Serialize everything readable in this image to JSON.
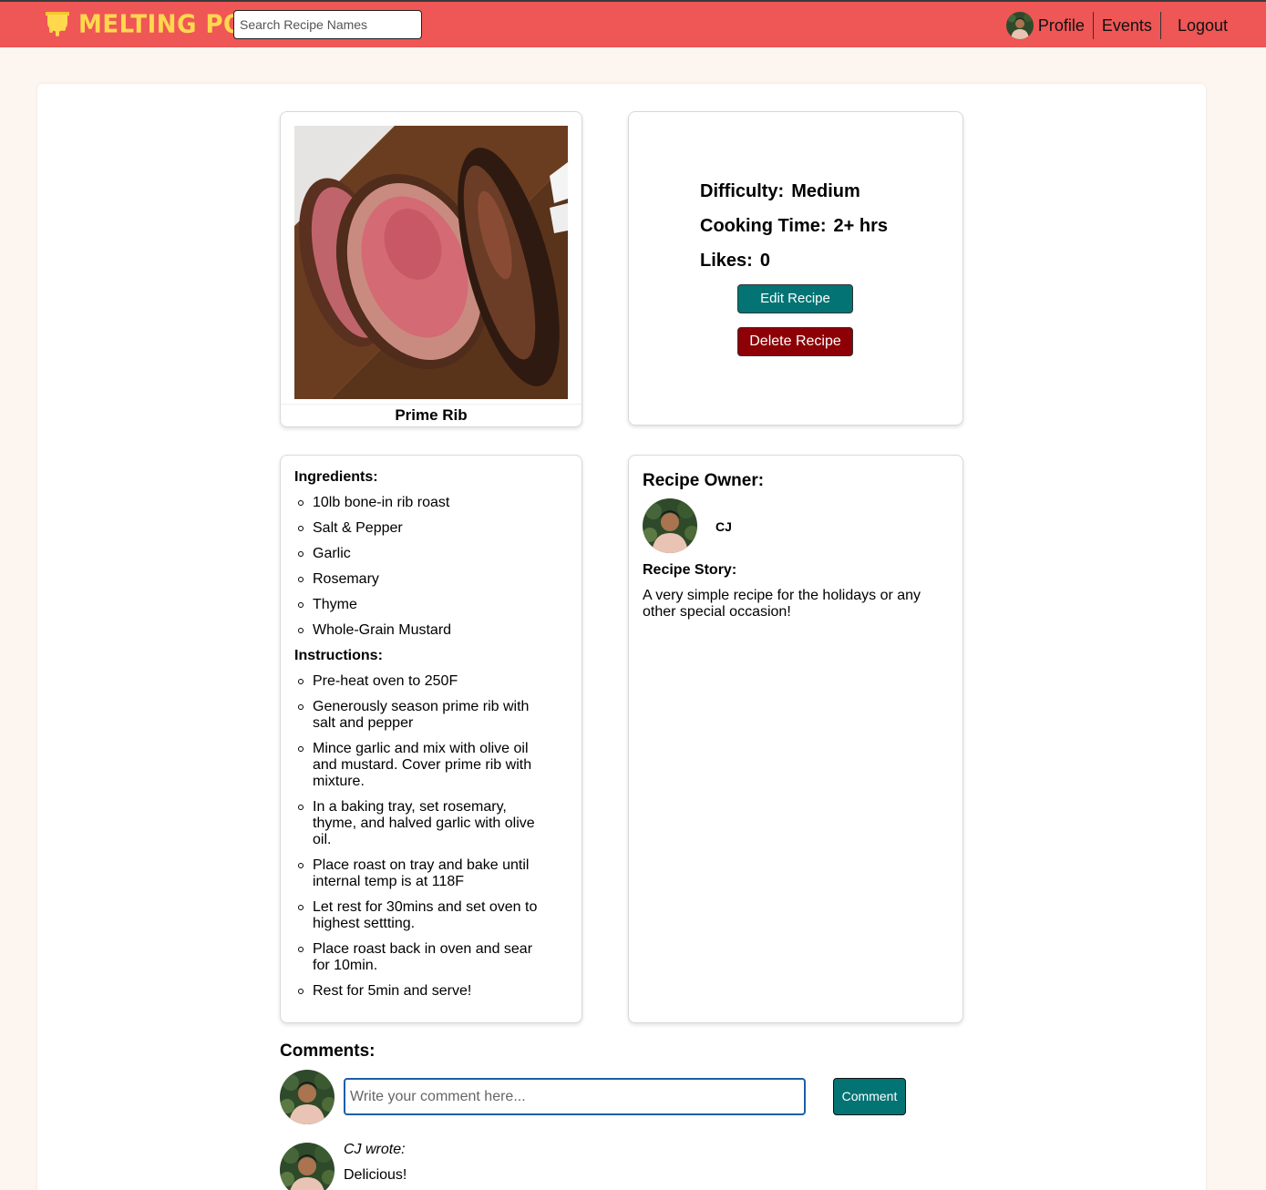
{
  "nav": {
    "logo_text": "MELTING POT",
    "search_placeholder": "Search Recipe Names",
    "profile_label": "Profile",
    "events_label": "Events",
    "logout_label": "Logout"
  },
  "recipe": {
    "name": "Prime Rib",
    "difficulty_label": "Difficulty:",
    "difficulty_value": "Medium",
    "cooking_time_label": "Cooking Time:",
    "cooking_time_value": "2+ hrs",
    "likes_label": "Likes:",
    "likes_value": "0",
    "edit_button": "Edit Recipe",
    "delete_button": "Delete Recipe",
    "ingredients_title": "Ingredients:",
    "ingredients": [
      "10lb bone-in rib roast",
      "Salt & Pepper",
      "Garlic",
      "Rosemary",
      "Thyme",
      "Whole-Grain Mustard"
    ],
    "instructions_title": "Instructions:",
    "instructions": [
      "Pre-heat oven to 250F",
      "Generously season prime rib with salt and pepper",
      "Mince garlic and mix with olive oil and mustard. Cover prime rib with mixture.",
      "In a baking tray, set rosemary, thyme, and halved garlic with olive oil.",
      "Place roast on tray and bake until internal temp is at 118F",
      "Let rest for 30mins and set oven to highest settting.",
      "Place roast back in oven and sear for 10min.",
      "Rest for 5min and serve!"
    ]
  },
  "owner": {
    "title": "Recipe Owner:",
    "name": "CJ",
    "story_title": "Recipe Story:",
    "story": "A very simple recipe for the holidays or any other special occasion!"
  },
  "comments": {
    "title": "Comments:",
    "input_placeholder": "Write your comment here...",
    "submit_label": "Comment",
    "items": [
      {
        "author": "CJ wrote:",
        "text": "Delicious!"
      }
    ]
  },
  "colors": {
    "navbar": "#ef5656",
    "logo": "#ffd84d",
    "edit_button": "#047374",
    "delete_button": "#8c0006",
    "page_background": "#fdf5ef"
  }
}
